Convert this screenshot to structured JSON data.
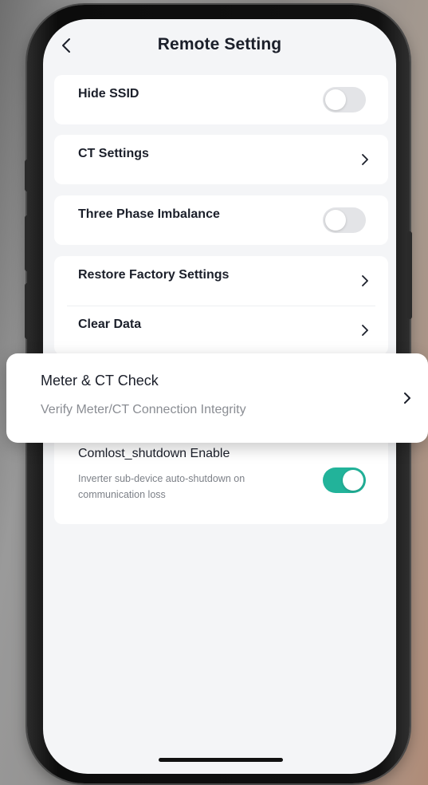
{
  "header": {
    "title": "Remote Setting",
    "back_icon": "chevron-left-icon"
  },
  "settings": {
    "hide_ssid": {
      "label": "Hide SSID",
      "enabled": false
    },
    "ct_settings": {
      "label": "CT Settings"
    },
    "three_phase_imbalance": {
      "label": "Three Phase Imbalance",
      "enabled": false
    },
    "restore_factory": {
      "label": "Restore Factory Settings"
    },
    "clear_data": {
      "label": "Clear Data"
    },
    "comlost_shutdown": {
      "label": "Comlost_shutdown Enable",
      "description": "Inverter sub-device auto-shutdown on communication loss",
      "enabled": true
    }
  },
  "popup": {
    "title": "Meter & CT Check",
    "subtitle": "Verify Meter/CT Connection Integrity"
  },
  "colors": {
    "accent": "#22b39a",
    "toggle_off": "#e3e4e7",
    "text_primary": "#1b1f2a",
    "text_secondary": "#8a8d93",
    "screen_bg": "#f4f5f7"
  }
}
